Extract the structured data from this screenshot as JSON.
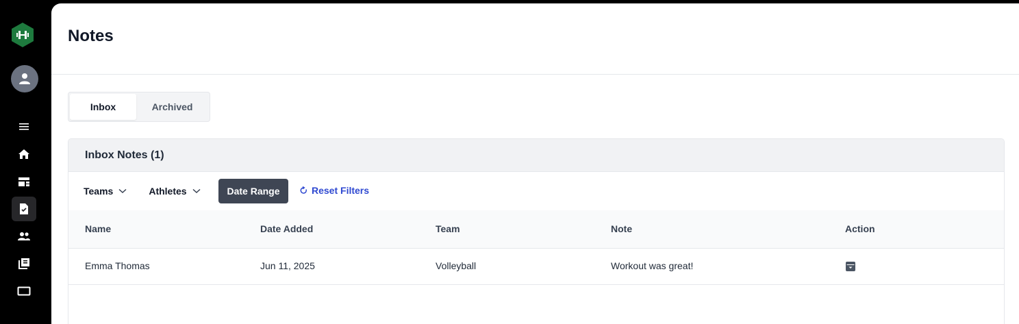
{
  "app": {
    "brand_color": "#1e7a3e",
    "sidebar_bg": "#000000"
  },
  "sidebar": {
    "items": [
      {
        "icon": "menu-icon",
        "active": false
      },
      {
        "icon": "home-icon",
        "active": false
      },
      {
        "icon": "dashboard-icon",
        "active": false
      },
      {
        "icon": "notes-icon",
        "active": true
      },
      {
        "icon": "people-icon",
        "active": false
      },
      {
        "icon": "library-icon",
        "active": false
      },
      {
        "icon": "tablet-icon",
        "active": false
      }
    ]
  },
  "page": {
    "title": "Notes"
  },
  "tabs": [
    {
      "label": "Inbox",
      "active": true
    },
    {
      "label": "Archived",
      "active": false
    }
  ],
  "card": {
    "title": "Inbox Notes (1)"
  },
  "filters": {
    "teams_label": "Teams",
    "athletes_label": "Athletes",
    "date_range_label": "Date Range",
    "reset_label": "Reset Filters"
  },
  "table": {
    "columns": [
      "Name",
      "Date Added",
      "Team",
      "Note",
      "Action"
    ],
    "rows": [
      {
        "name": "Emma Thomas",
        "date_added": "Jun 11, 2025",
        "team": "Volleyball",
        "note": "Workout was great!",
        "action_icon": "archive-icon"
      }
    ]
  },
  "colors": {
    "accent_link": "#2f49d1",
    "dark_button": "#3f4654"
  }
}
